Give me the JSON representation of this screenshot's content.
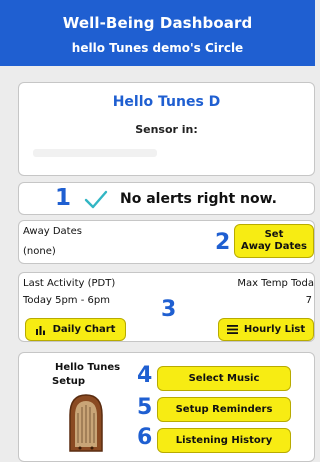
{
  "header": {
    "title": "Well-Being Dashboard",
    "subtitle": "hello Tunes demo's Circle"
  },
  "profile": {
    "name": "Hello Tunes D",
    "sensor_label": "Sensor in:"
  },
  "alerts": {
    "step": "1",
    "message": "No alerts right now."
  },
  "away": {
    "label": "Away Dates",
    "value": "(none)",
    "step": "2",
    "button_line1": "Set",
    "button_line2": "Away Dates"
  },
  "activity": {
    "label": "Last Activity (PDT)",
    "value": "Today  5pm - 6pm",
    "temp_label": "Max Temp Toda",
    "temp_value": "7",
    "step": "3",
    "daily_button": "Daily Chart",
    "hourly_button": "Hourly List"
  },
  "setup": {
    "title_line1": "Hello Tunes",
    "title_line2": "Setup",
    "step_music": "4",
    "step_reminders": "5",
    "step_history": "6",
    "music_button": "Select Music",
    "reminders_button": "Setup Reminders",
    "history_button": "Listening History"
  },
  "icons": {
    "alert_status": "checkmark-icon",
    "daily_chart": "bar-chart-icon",
    "hourly_list": "list-icon",
    "device": "vintage-radio-icon"
  },
  "colors": {
    "header": "#1f5fd1",
    "accent_blue": "#1f5fd1",
    "button_yellow": "#f7ec13",
    "check_teal": "#32b6c4",
    "background": "#ececec"
  }
}
